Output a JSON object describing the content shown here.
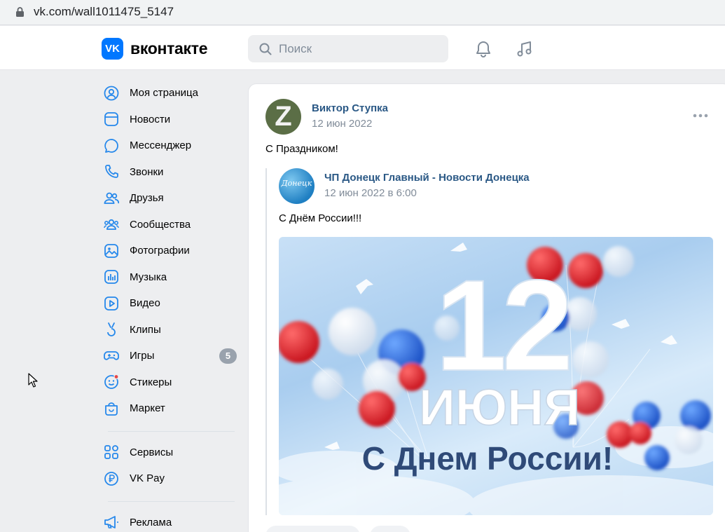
{
  "browser": {
    "url": "vk.com/wall1011475_5147"
  },
  "header": {
    "logo_text": "вконтакте",
    "logo_mark": "VK",
    "search_placeholder": "Поиск",
    "brand_color": "#0077ff"
  },
  "menu": {
    "items": [
      {
        "label": "Моя страница",
        "icon": "profile-icon"
      },
      {
        "label": "Новости",
        "icon": "news-icon"
      },
      {
        "label": "Мессенджер",
        "icon": "message-icon"
      },
      {
        "label": "Звонки",
        "icon": "phone-icon"
      },
      {
        "label": "Друзья",
        "icon": "friends-icon"
      },
      {
        "label": "Сообщества",
        "icon": "communities-icon"
      },
      {
        "label": "Фотографии",
        "icon": "photo-icon"
      },
      {
        "label": "Музыка",
        "icon": "music-icon"
      },
      {
        "label": "Видео",
        "icon": "video-icon"
      },
      {
        "label": "Клипы",
        "icon": "clips-icon"
      },
      {
        "label": "Игры",
        "icon": "games-icon",
        "badge": "5"
      },
      {
        "label": "Стикеры",
        "icon": "stickers-icon"
      },
      {
        "label": "Маркет",
        "icon": "market-icon"
      }
    ],
    "secondary": [
      {
        "label": "Сервисы",
        "icon": "services-icon"
      },
      {
        "label": "VK Pay",
        "icon": "vkpay-icon"
      }
    ],
    "tertiary": [
      {
        "label": "Реклама",
        "icon": "ads-icon"
      }
    ]
  },
  "post": {
    "author": "Виктор Ступка",
    "avatar_letter": "Z",
    "date": "12 июн 2022",
    "text": "С Праздником!",
    "repost": {
      "author": "ЧП Донецк Главный - Новости Донецка",
      "avatar_text": "Донецк",
      "date": "12 июн 2022 в 6:00",
      "text": "С Днём России!!!",
      "image": {
        "big_number": "12",
        "month": "ИЮНЯ",
        "caption": "С Днем России!"
      }
    }
  }
}
